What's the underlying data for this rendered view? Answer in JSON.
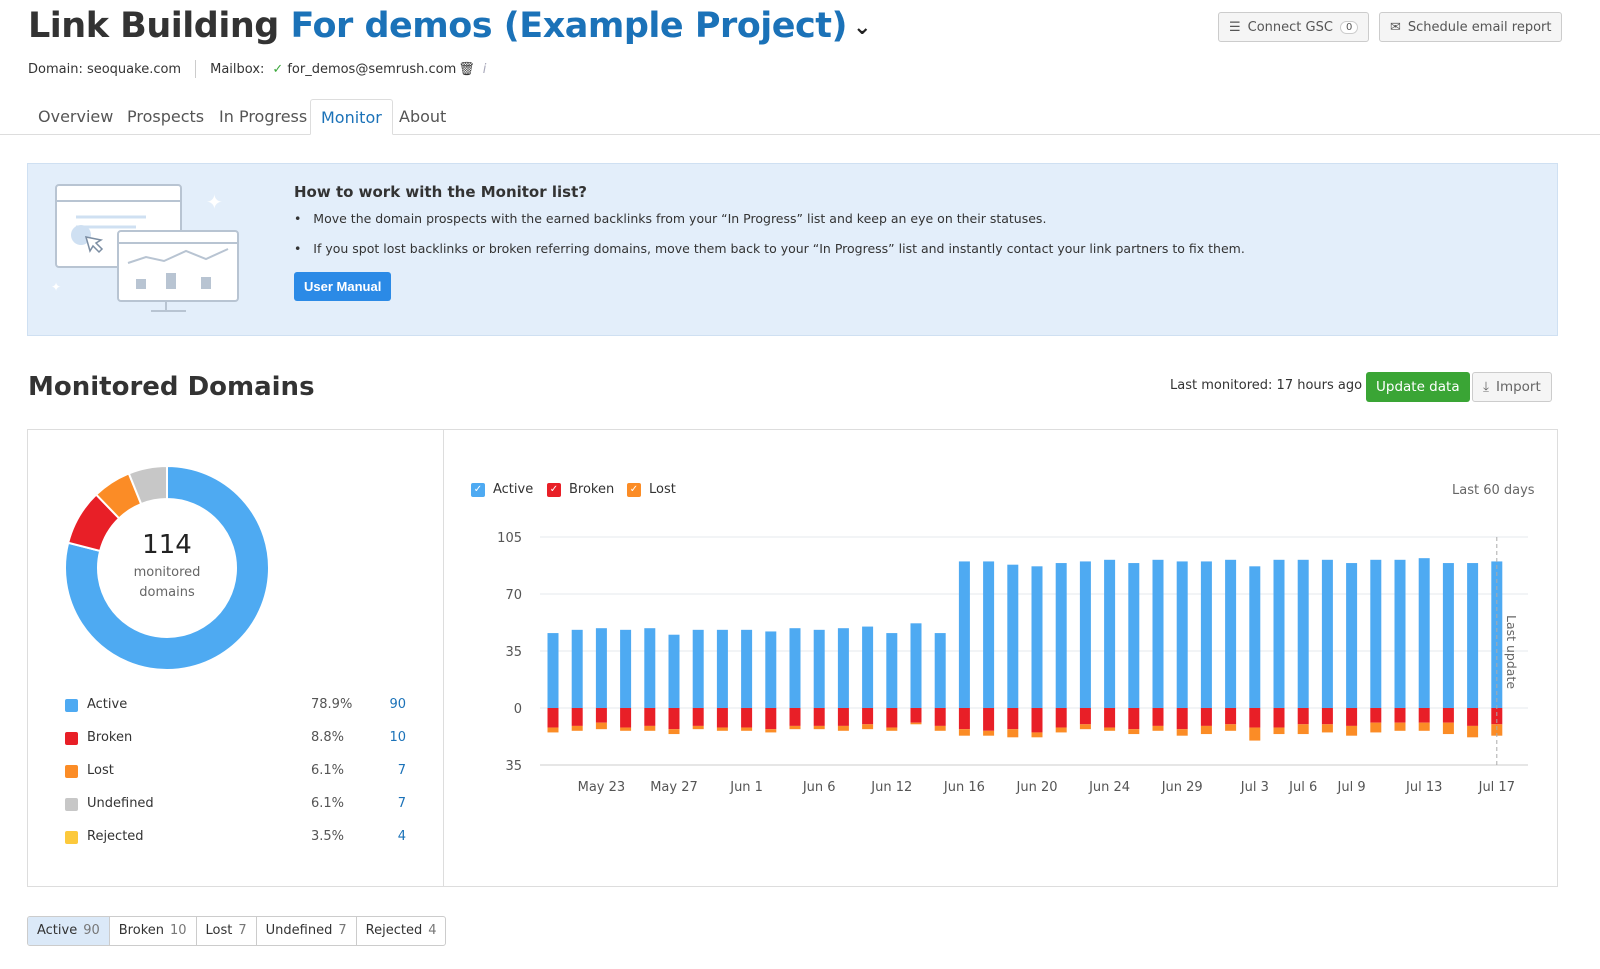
{
  "header": {
    "title_prefix": "Link Building",
    "project": "For demos (Example Project)",
    "domain_label": "Domain: seoquake.com",
    "mailbox_label": "Mailbox:",
    "mailbox": "for_demos@semrush.com",
    "connect_gsc": "Connect GSC",
    "gsc_count": "0",
    "schedule": "Schedule email report"
  },
  "tabs": [
    {
      "label": "Overview"
    },
    {
      "label": "Prospects"
    },
    {
      "label": "In Progress"
    },
    {
      "label": "Monitor",
      "active": true
    },
    {
      "label": "About"
    }
  ],
  "banner": {
    "title": "How to work with the Monitor list?",
    "bullets": [
      "Move the domain prospects with the earned backlinks from your “In Progress” list and keep an eye on their statuses.",
      "If you spot lost backlinks or broken referring domains, move them back to your “In Progress” list and instantly contact your link partners to fix them."
    ],
    "button": "User Manual"
  },
  "monitored": {
    "title": "Monitored Domains",
    "last_monitored": "Last monitored: 17 hours ago",
    "update": "Update data",
    "import": "Import"
  },
  "donut": {
    "total": "114",
    "label": "monitored domains",
    "items": [
      {
        "name": "Active",
        "pct": "78.9%",
        "count": "90",
        "color": "#4eaaf2",
        "value": 78.9
      },
      {
        "name": "Broken",
        "pct": "8.8%",
        "count": "10",
        "color": "#e81f27",
        "value": 8.8
      },
      {
        "name": "Lost",
        "pct": "6.1%",
        "count": "7",
        "color": "#fb8c26",
        "value": 6.1
      },
      {
        "name": "Undefined",
        "pct": "6.1%",
        "count": "7",
        "color": "#c7c7c7",
        "value": 6.1
      },
      {
        "name": "Rejected",
        "pct": "3.5%",
        "count": "4",
        "color": "#fcc93c",
        "value": 0
      }
    ]
  },
  "chart_data": {
    "type": "bar",
    "period": "Last 60 days",
    "legend": [
      {
        "name": "Active",
        "color": "#4eaaf2"
      },
      {
        "name": "Broken",
        "color": "#e81f27"
      },
      {
        "name": "Lost",
        "color": "#fb8c26"
      }
    ],
    "y_ticks": [
      "105",
      "70",
      "35",
      "0",
      "35"
    ],
    "ylim": [
      -35,
      105
    ],
    "annotation": "Last update",
    "categories": [
      "",
      "",
      "May 23",
      "",
      "",
      "May 27",
      "",
      "",
      "Jun 1",
      "",
      "",
      "Jun 6",
      "",
      "",
      "Jun 12",
      "",
      "",
      "Jun 16",
      "",
      "",
      "Jun 20",
      "",
      "",
      "Jun 24",
      "",
      "",
      "Jun 29",
      "",
      "",
      "Jul 3",
      "",
      "Jul 6",
      "",
      "Jul 9",
      "",
      "",
      "Jul 13",
      "",
      "",
      "Jul 17"
    ],
    "series": [
      {
        "name": "Active",
        "values": [
          46,
          48,
          49,
          48,
          49,
          45,
          48,
          48,
          48,
          47,
          49,
          48,
          49,
          50,
          46,
          52,
          46,
          90,
          90,
          88,
          87,
          89,
          90,
          91,
          89,
          91,
          90,
          90,
          91,
          87,
          91,
          91,
          91,
          89,
          91,
          91,
          92,
          89,
          89,
          90
        ]
      },
      {
        "name": "Broken",
        "values": [
          12,
          11,
          9,
          12,
          11,
          13,
          11,
          12,
          12,
          13,
          11,
          11,
          11,
          10,
          12,
          9,
          11,
          13,
          14,
          13,
          15,
          12,
          10,
          12,
          13,
          11,
          13,
          11,
          10,
          12,
          12,
          10,
          10,
          11,
          9,
          9,
          9,
          9,
          11,
          10
        ]
      },
      {
        "name": "Lost",
        "values": [
          3,
          3,
          4,
          2,
          3,
          3,
          2,
          2,
          2,
          2,
          2,
          2,
          3,
          3,
          2,
          1,
          3,
          4,
          3,
          5,
          3,
          3,
          3,
          2,
          3,
          3,
          4,
          5,
          4,
          8,
          4,
          6,
          5,
          6,
          6,
          5,
          5,
          7,
          7,
          7
        ]
      }
    ]
  },
  "filters": [
    {
      "label": "Active",
      "count": "90",
      "active": true
    },
    {
      "label": "Broken",
      "count": "10"
    },
    {
      "label": "Lost",
      "count": "7"
    },
    {
      "label": "Undefined",
      "count": "7"
    },
    {
      "label": "Rejected",
      "count": "4"
    }
  ]
}
